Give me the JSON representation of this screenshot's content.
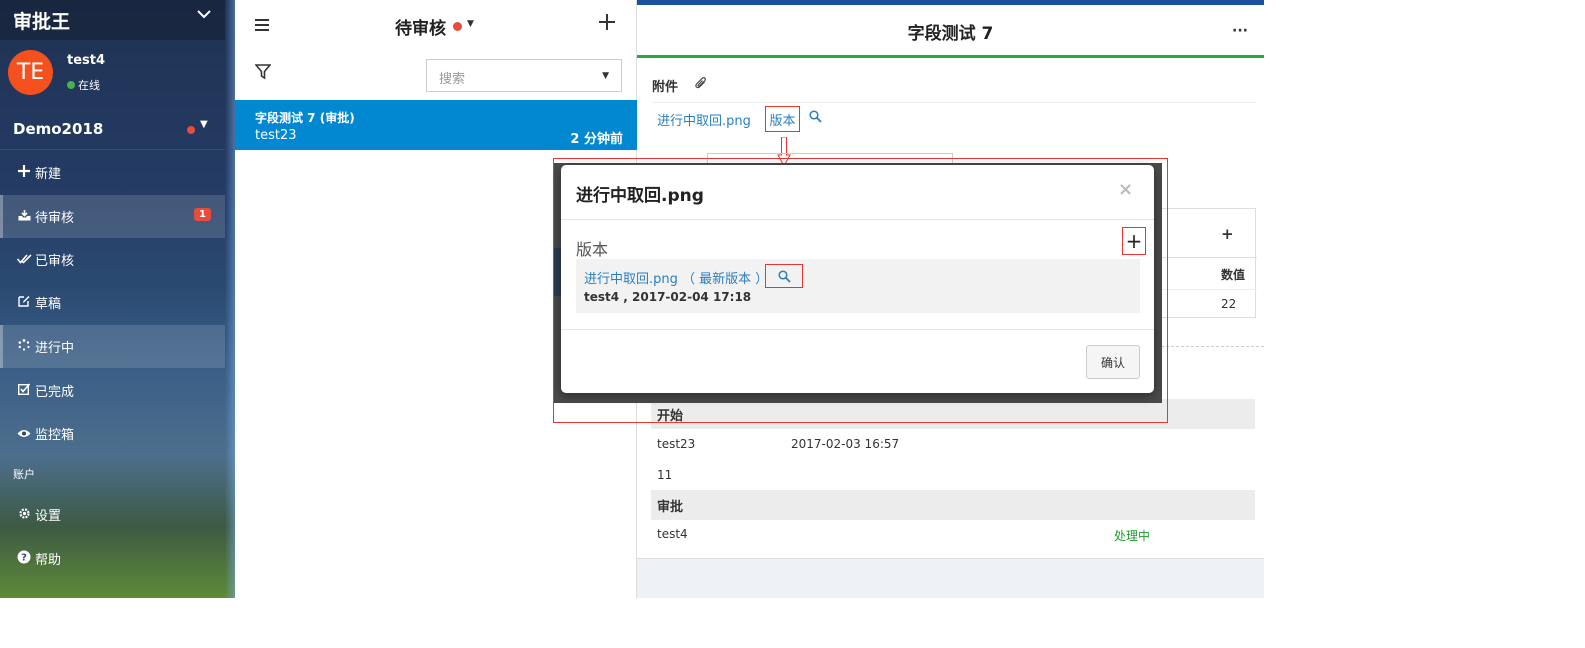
{
  "app": {
    "brand": "审批王"
  },
  "user": {
    "avatar_initials": "TE",
    "name": "test4",
    "status": "在线",
    "status_color": "#4caf50"
  },
  "org": {
    "name": "Demo2018"
  },
  "nav": [
    {
      "label": "新建",
      "icon": "plus-icon"
    },
    {
      "label": "待审核",
      "icon": "inbox-icon",
      "badge": "1"
    },
    {
      "label": "已审核",
      "icon": "double-check-icon"
    },
    {
      "label": "草稿",
      "icon": "edit-icon"
    },
    {
      "label": "进行中",
      "icon": "spinner-icon"
    },
    {
      "label": "已完成",
      "icon": "checkbox-icon"
    },
    {
      "label": "监控箱",
      "icon": "eye-icon"
    }
  ],
  "account": {
    "section_label": "账户",
    "items": [
      {
        "label": "设置",
        "icon": "gear-icon"
      },
      {
        "label": "帮助",
        "icon": "help-icon"
      }
    ]
  },
  "list": {
    "title": "待审核",
    "search_placeholder": "搜索",
    "items": [
      {
        "title": "字段测试 7 (审批)",
        "subtitle": "test23",
        "time": "2 分钟前"
      }
    ]
  },
  "detail": {
    "title": "字段测试 7",
    "more": "···",
    "attachments_label": "附件",
    "attachment_name": "进行中取回.png",
    "version_link": "版本",
    "card": {
      "plus": "+",
      "column": "数值",
      "value": "22"
    },
    "sections": [
      {
        "header": "开始",
        "user": "test23",
        "time": "2017-02-03 16:57",
        "extra": "11"
      },
      {
        "header": "审批",
        "user": "test4",
        "status": "处理中"
      }
    ]
  },
  "modal": {
    "title": "进行中取回.png",
    "close": "×",
    "section": "版本",
    "add": "+",
    "version_file": "进行中取回.png （ 最新版本 ）",
    "version_meta": "test4 , 2017-02-04 17:18",
    "confirm": "确认"
  },
  "colors": {
    "accent": "#0288d1",
    "danger": "#e74c3c",
    "success": "#27a745",
    "link": "#2a7fc1"
  }
}
